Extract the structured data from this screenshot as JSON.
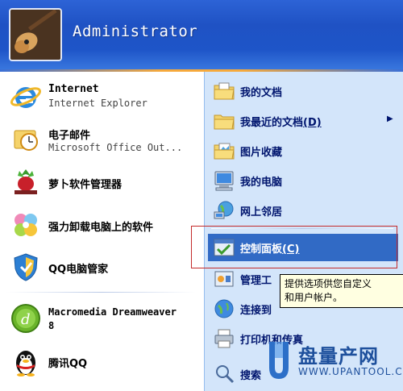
{
  "header": {
    "username": "Administrator"
  },
  "left_items": [
    {
      "label": "Internet",
      "sublabel": "Internet Explorer",
      "icon": "internet-explorer-icon"
    },
    {
      "label": "电子邮件",
      "sublabel": "Microsoft Office Out...",
      "icon": "outlook-icon"
    },
    {
      "label": "萝卜软件管理器",
      "icon": "radish-software-manager-icon"
    },
    {
      "label": "强力卸载电脑上的软件",
      "icon": "uninstaller-icon"
    },
    {
      "label": "QQ电脑管家",
      "icon": "qq-pc-manager-icon"
    },
    {
      "label": "Macromedia Dreamweaver 8",
      "line1": "Macromedia Dreamweaver",
      "line2": "8",
      "icon": "dreamweaver-icon"
    },
    {
      "label": "腾讯QQ",
      "icon": "qq-penguin-icon"
    }
  ],
  "right_items": [
    {
      "label": "我的文档",
      "icon": "documents-folder-icon"
    },
    {
      "label": "我最近的文档(D)",
      "label_main": "我最近的文档",
      "label_key": "(D)",
      "icon": "recent-folder-icon",
      "arrow": "▶"
    },
    {
      "label": "图片收藏",
      "icon": "pictures-folder-icon"
    },
    {
      "label": "我的电脑",
      "icon": "my-computer-icon"
    },
    {
      "label": "网上邻居",
      "icon": "network-icon"
    },
    {
      "label": "控制面板(C)",
      "label_main": "控制面板",
      "label_key": "(C)",
      "icon": "control-panel-icon",
      "highlighted": true
    },
    {
      "label": "管理工",
      "icon": "admin-tools-icon"
    },
    {
      "label": "连接到",
      "icon": "connect-icon"
    },
    {
      "label": "打印机和传真",
      "icon": "printer-icon"
    },
    {
      "label": "搜索",
      "icon": "search-icon"
    }
  ],
  "tooltip": {
    "line1": "提供选项供您自定义",
    "line2": "和用户帐户。"
  },
  "watermark": {
    "brand": "盘量产网",
    "url": "WWW.UPANTOOL.COM"
  },
  "colors": {
    "header": "#2258c9",
    "right_panel": "#d3e5fa",
    "highlight": "#316ac5",
    "red_box": "#c42b2b"
  }
}
